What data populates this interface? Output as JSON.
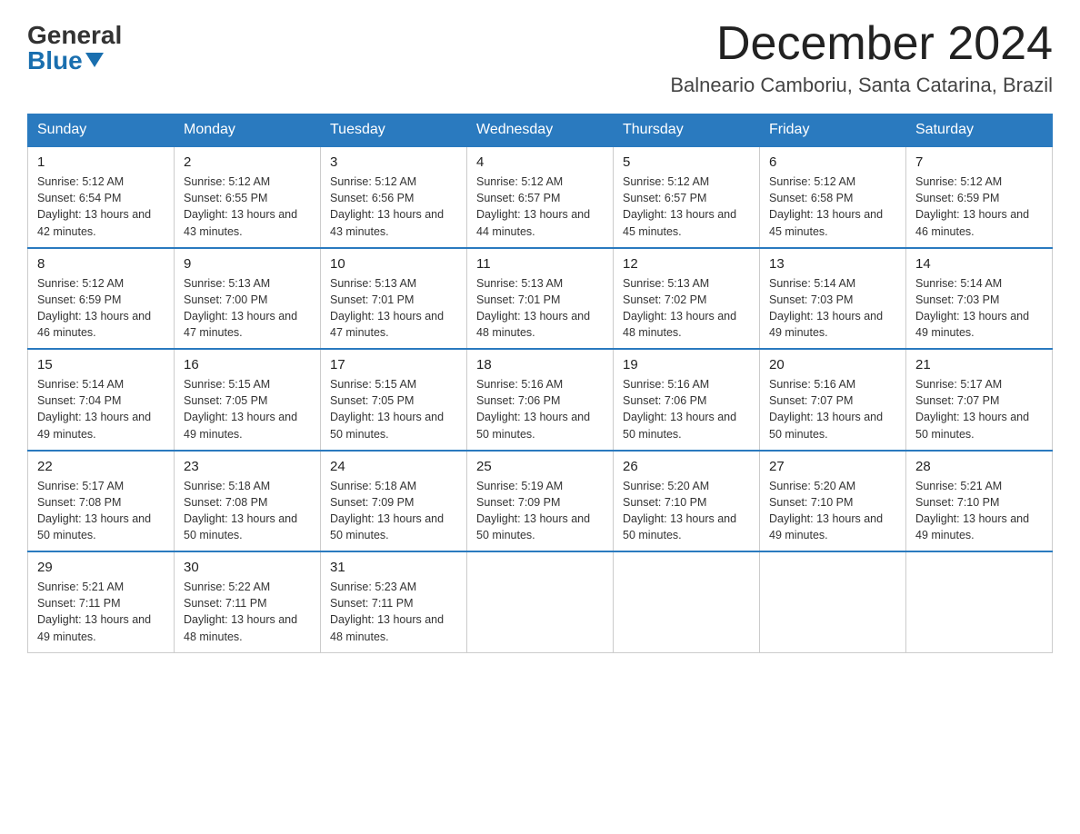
{
  "logo": {
    "general": "General",
    "blue": "Blue"
  },
  "title": "December 2024",
  "location": "Balneario Camboriu, Santa Catarina, Brazil",
  "days_of_week": [
    "Sunday",
    "Monday",
    "Tuesday",
    "Wednesday",
    "Thursday",
    "Friday",
    "Saturday"
  ],
  "weeks": [
    [
      {
        "day": "1",
        "sunrise": "5:12 AM",
        "sunset": "6:54 PM",
        "daylight": "13 hours and 42 minutes."
      },
      {
        "day": "2",
        "sunrise": "5:12 AM",
        "sunset": "6:55 PM",
        "daylight": "13 hours and 43 minutes."
      },
      {
        "day": "3",
        "sunrise": "5:12 AM",
        "sunset": "6:56 PM",
        "daylight": "13 hours and 43 minutes."
      },
      {
        "day": "4",
        "sunrise": "5:12 AM",
        "sunset": "6:57 PM",
        "daylight": "13 hours and 44 minutes."
      },
      {
        "day": "5",
        "sunrise": "5:12 AM",
        "sunset": "6:57 PM",
        "daylight": "13 hours and 45 minutes."
      },
      {
        "day": "6",
        "sunrise": "5:12 AM",
        "sunset": "6:58 PM",
        "daylight": "13 hours and 45 minutes."
      },
      {
        "day": "7",
        "sunrise": "5:12 AM",
        "sunset": "6:59 PM",
        "daylight": "13 hours and 46 minutes."
      }
    ],
    [
      {
        "day": "8",
        "sunrise": "5:12 AM",
        "sunset": "6:59 PM",
        "daylight": "13 hours and 46 minutes."
      },
      {
        "day": "9",
        "sunrise": "5:13 AM",
        "sunset": "7:00 PM",
        "daylight": "13 hours and 47 minutes."
      },
      {
        "day": "10",
        "sunrise": "5:13 AM",
        "sunset": "7:01 PM",
        "daylight": "13 hours and 47 minutes."
      },
      {
        "day": "11",
        "sunrise": "5:13 AM",
        "sunset": "7:01 PM",
        "daylight": "13 hours and 48 minutes."
      },
      {
        "day": "12",
        "sunrise": "5:13 AM",
        "sunset": "7:02 PM",
        "daylight": "13 hours and 48 minutes."
      },
      {
        "day": "13",
        "sunrise": "5:14 AM",
        "sunset": "7:03 PM",
        "daylight": "13 hours and 49 minutes."
      },
      {
        "day": "14",
        "sunrise": "5:14 AM",
        "sunset": "7:03 PM",
        "daylight": "13 hours and 49 minutes."
      }
    ],
    [
      {
        "day": "15",
        "sunrise": "5:14 AM",
        "sunset": "7:04 PM",
        "daylight": "13 hours and 49 minutes."
      },
      {
        "day": "16",
        "sunrise": "5:15 AM",
        "sunset": "7:05 PM",
        "daylight": "13 hours and 49 minutes."
      },
      {
        "day": "17",
        "sunrise": "5:15 AM",
        "sunset": "7:05 PM",
        "daylight": "13 hours and 50 minutes."
      },
      {
        "day": "18",
        "sunrise": "5:16 AM",
        "sunset": "7:06 PM",
        "daylight": "13 hours and 50 minutes."
      },
      {
        "day": "19",
        "sunrise": "5:16 AM",
        "sunset": "7:06 PM",
        "daylight": "13 hours and 50 minutes."
      },
      {
        "day": "20",
        "sunrise": "5:16 AM",
        "sunset": "7:07 PM",
        "daylight": "13 hours and 50 minutes."
      },
      {
        "day": "21",
        "sunrise": "5:17 AM",
        "sunset": "7:07 PM",
        "daylight": "13 hours and 50 minutes."
      }
    ],
    [
      {
        "day": "22",
        "sunrise": "5:17 AM",
        "sunset": "7:08 PM",
        "daylight": "13 hours and 50 minutes."
      },
      {
        "day": "23",
        "sunrise": "5:18 AM",
        "sunset": "7:08 PM",
        "daylight": "13 hours and 50 minutes."
      },
      {
        "day": "24",
        "sunrise": "5:18 AM",
        "sunset": "7:09 PM",
        "daylight": "13 hours and 50 minutes."
      },
      {
        "day": "25",
        "sunrise": "5:19 AM",
        "sunset": "7:09 PM",
        "daylight": "13 hours and 50 minutes."
      },
      {
        "day": "26",
        "sunrise": "5:20 AM",
        "sunset": "7:10 PM",
        "daylight": "13 hours and 50 minutes."
      },
      {
        "day": "27",
        "sunrise": "5:20 AM",
        "sunset": "7:10 PM",
        "daylight": "13 hours and 49 minutes."
      },
      {
        "day": "28",
        "sunrise": "5:21 AM",
        "sunset": "7:10 PM",
        "daylight": "13 hours and 49 minutes."
      }
    ],
    [
      {
        "day": "29",
        "sunrise": "5:21 AM",
        "sunset": "7:11 PM",
        "daylight": "13 hours and 49 minutes."
      },
      {
        "day": "30",
        "sunrise": "5:22 AM",
        "sunset": "7:11 PM",
        "daylight": "13 hours and 48 minutes."
      },
      {
        "day": "31",
        "sunrise": "5:23 AM",
        "sunset": "7:11 PM",
        "daylight": "13 hours and 48 minutes."
      },
      null,
      null,
      null,
      null
    ]
  ]
}
